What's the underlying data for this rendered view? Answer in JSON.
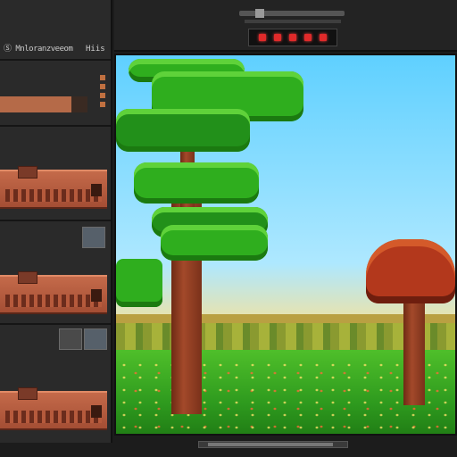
{
  "sidebar": {
    "title": "Ⓢ Mnloranzveeom",
    "title_right": "Hiis",
    "progress": 0.82
  },
  "toolbar": {
    "record_indicators": [
      "rec-indicator",
      "rec-indicator",
      "rec-indicator",
      "rec-indicator",
      "rec-indicator"
    ],
    "slider_value": 0.15
  },
  "colors": {
    "accent": "#b56a48",
    "record": "#e02a2a",
    "panel": "#2a2a2a",
    "sky": "#5fd0ff",
    "grass": "#2e9a1e"
  },
  "canvas": {
    "description_icon": "image-canvas"
  },
  "scrollbar": {
    "position": 0.06
  }
}
